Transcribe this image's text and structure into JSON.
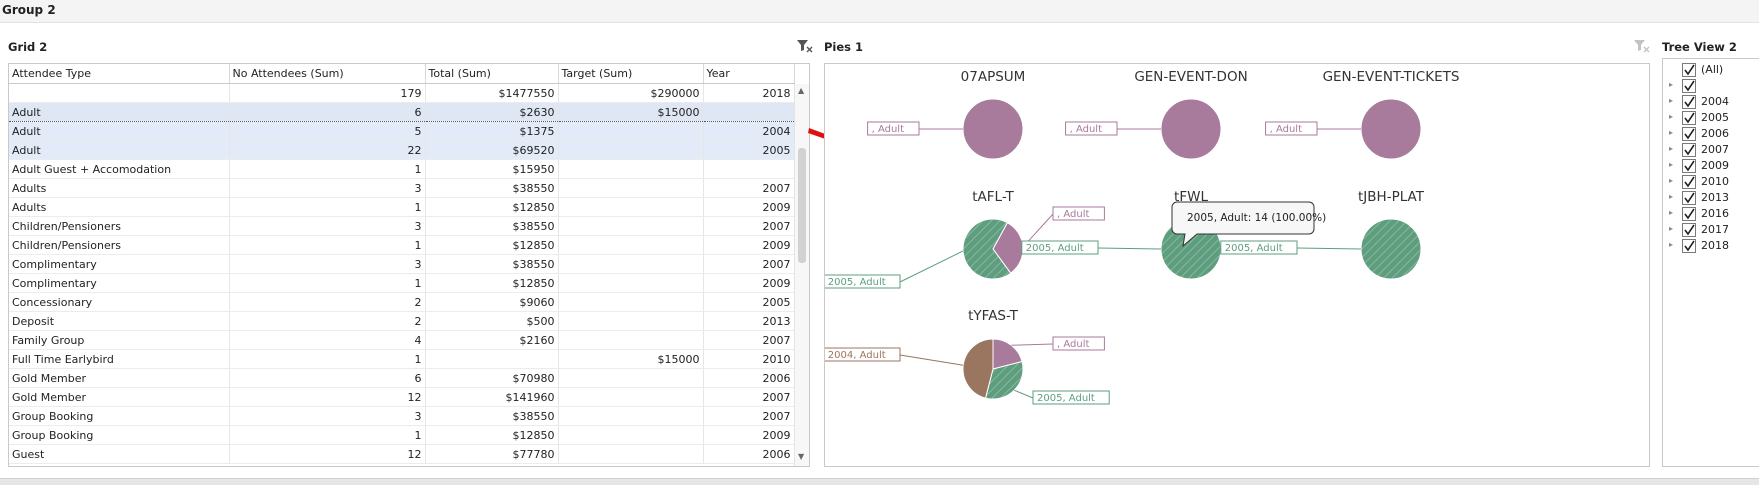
{
  "group": {
    "title": "Group 2"
  },
  "grid": {
    "title": "Grid 2",
    "columns": [
      "Attendee Type",
      "No Attendees (Sum)",
      "Total (Sum)",
      "Target (Sum)",
      "Year"
    ],
    "rows": [
      [
        "",
        "179",
        "$1477550",
        "$290000",
        "2018"
      ],
      [
        "Adult",
        "6",
        "$2630",
        "$15000",
        ""
      ],
      [
        "Adult",
        "5",
        "$1375",
        "",
        "2004"
      ],
      [
        "Adult",
        "22",
        "$69520",
        "",
        "2005"
      ],
      [
        "Adult Guest + Accomodation",
        "1",
        "$15950",
        "",
        ""
      ],
      [
        "Adults",
        "3",
        "$38550",
        "",
        "2007"
      ],
      [
        "Adults",
        "1",
        "$12850",
        "",
        "2009"
      ],
      [
        "Children/Pensioners",
        "3",
        "$38550",
        "",
        "2007"
      ],
      [
        "Children/Pensioners",
        "1",
        "$12850",
        "",
        "2009"
      ],
      [
        "Complimentary",
        "3",
        "$38550",
        "",
        "2007"
      ],
      [
        "Complimentary",
        "1",
        "$12850",
        "",
        "2009"
      ],
      [
        "Concessionary",
        "2",
        "$9060",
        "",
        "2005"
      ],
      [
        "Deposit",
        "2",
        "$500",
        "",
        "2013"
      ],
      [
        "Family Group",
        "4",
        "$2160",
        "",
        "2007"
      ],
      [
        "Full Time Earlybird",
        "1",
        "",
        "$15000",
        "2010"
      ],
      [
        "Gold Member",
        "6",
        "$70980",
        "",
        "2006"
      ],
      [
        "Gold Member",
        "12",
        "$141960",
        "",
        "2007"
      ],
      [
        "Group Booking",
        "3",
        "$38550",
        "",
        "2007"
      ],
      [
        "Group Booking",
        "1",
        "$12850",
        "",
        "2009"
      ],
      [
        "Guest",
        "12",
        "$77780",
        "",
        "2006"
      ]
    ]
  },
  "pies": {
    "title": "Pies 1",
    "charts": [
      {
        "title": "07APSUM"
      },
      {
        "title": "GEN-EVENT-DON"
      },
      {
        "title": "GEN-EVENT-TICKETS"
      },
      {
        "title": "tAFL-T"
      },
      {
        "title": "tFWL"
      },
      {
        "title": "tJBH-PLAT"
      },
      {
        "title": "tYFAS-T"
      }
    ],
    "tooltip": "2005, Adult: 14 (100.00%)"
  },
  "chart_data": {
    "type": "pie",
    "pies": [
      {
        "title": "07APSUM",
        "slices": [
          {
            "label": ", Adult",
            "share": 1.0
          }
        ]
      },
      {
        "title": "GEN-EVENT-DON",
        "slices": [
          {
            "label": ", Adult",
            "share": 1.0
          }
        ]
      },
      {
        "title": "GEN-EVENT-TICKETS",
        "slices": [
          {
            "label": ", Adult",
            "share": 1.0
          }
        ]
      },
      {
        "title": "tAFL-T",
        "slices": [
          {
            "label": ", Adult",
            "share": 0.32
          },
          {
            "label": "2005, Adult",
            "share": 0.68
          }
        ]
      },
      {
        "title": "tFWL",
        "slices": [
          {
            "label": "2005, Adult",
            "value": 14,
            "share": 1.0
          }
        ]
      },
      {
        "title": "tJBH-PLAT",
        "slices": [
          {
            "label": "2005, Adult",
            "share": 1.0
          }
        ]
      },
      {
        "title": "tYFAS-T",
        "slices": [
          {
            "label": ", Adult",
            "share": 0.21
          },
          {
            "label": "2005, Adult",
            "share": 0.33
          },
          {
            "label": "2004, Adult",
            "share": 0.46
          }
        ]
      }
    ],
    "colors": {
      ", Adult": "#a87a9c",
      "2005, Adult": "#5e9e7f",
      "2004, Adult": "#9a7560"
    }
  },
  "tree": {
    "title": "Tree View 2",
    "items": [
      "(All)",
      "",
      "2004",
      "2005",
      "2006",
      "2007",
      "2009",
      "2010",
      "2013",
      "2016",
      "2017",
      "2018"
    ]
  }
}
